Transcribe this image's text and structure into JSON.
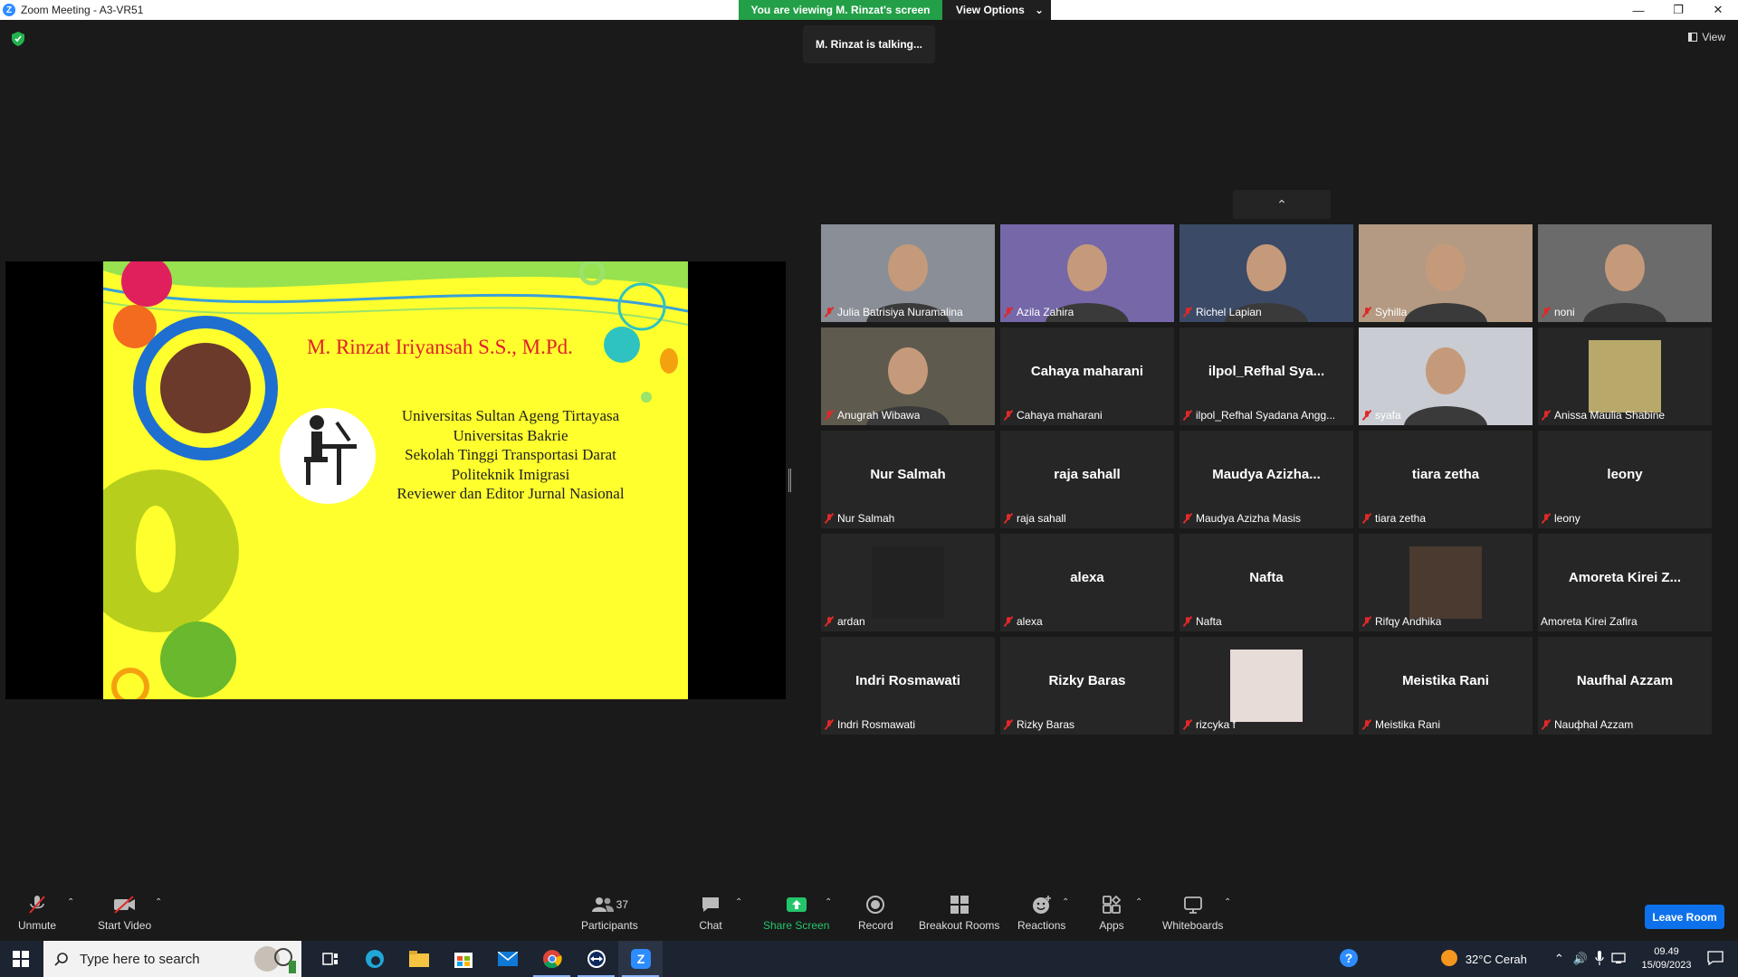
{
  "window": {
    "title": "Zoom Meeting - A3-VR51"
  },
  "banner": {
    "viewing_text": "You are viewing M. Rinzat's screen",
    "options_label": "View Options"
  },
  "talking": "M. Rinzat is talking...",
  "view_label": "View",
  "slide": {
    "name": "M. Rinzat Iriyansah S.S., M.Pd.",
    "lines": [
      "Universitas Sultan Ageng Tirtayasa",
      "Universitas Bakrie",
      "Sekolah Tinggi Transportasi Darat",
      "Politeknik Imigrasi",
      "Reviewer dan Editor Jurnal Nasional"
    ]
  },
  "participants": [
    {
      "label": "Julia Batrisiya Nuramalina",
      "big": "",
      "video": true,
      "bg": "#8a8f97"
    },
    {
      "label": "Azila Zahira",
      "big": "",
      "video": true,
      "bg": "#7567a8"
    },
    {
      "label": "Richel Lapian",
      "big": "",
      "video": true,
      "bg": "#3b4a66"
    },
    {
      "label": "Syhilla",
      "big": "",
      "video": true,
      "bg": "#b49a82"
    },
    {
      "label": "noni",
      "big": "",
      "video": true,
      "bg": "#6b6b6b"
    },
    {
      "label": "Anugrah Wibawa",
      "big": "",
      "video": true,
      "bg": "#5f5a4e"
    },
    {
      "label": "Cahaya maharani",
      "big": "Cahaya maharani",
      "video": false
    },
    {
      "label": "ilpol_Refhal Syadana Angg...",
      "big": "ilpol_Refhal  Sya...",
      "video": false
    },
    {
      "label": "syafa",
      "big": "",
      "video": true,
      "bg": "#c9ccd3"
    },
    {
      "label": "Anissa Maulia Shabine",
      "big": "",
      "video": false,
      "avatar": "#b8a86a"
    },
    {
      "label": "Nur Salmah",
      "big": "Nur Salmah",
      "video": false
    },
    {
      "label": "raja sahall",
      "big": "raja sahall",
      "video": false
    },
    {
      "label": "Maudya Azizha Masis",
      "big": "Maudya  Azizha...",
      "video": false
    },
    {
      "label": "tiara zetha",
      "big": "tiara zetha",
      "video": false
    },
    {
      "label": "leony",
      "big": "leony",
      "video": false
    },
    {
      "label": "ardan",
      "big": "",
      "video": false,
      "avatar": "#222222"
    },
    {
      "label": "alexa",
      "big": "alexa",
      "video": false
    },
    {
      "label": "Nafta",
      "big": "Nafta",
      "video": false
    },
    {
      "label": "Rifqy Andhika",
      "big": "",
      "video": false,
      "avatar": "#4a3a30"
    },
    {
      "label": "Amoreta Kirei Zafira",
      "big": "Amoreta  Kirei  Z...",
      "video": false,
      "nomic": true
    },
    {
      "label": "Indri Rosmawati",
      "big": "Indri Rosmawati",
      "video": false
    },
    {
      "label": "Rizky Baras",
      "big": "Rizky Baras",
      "video": false
    },
    {
      "label": "rizcyka f",
      "big": "",
      "video": false,
      "avatar": "#e8dcd8"
    },
    {
      "label": "Meistika Rani",
      "big": "Meistika Rani",
      "video": false
    },
    {
      "label": "Nauфhal Azzam",
      "big": "Naufhal Azzam",
      "video": false
    }
  ],
  "toolbar": {
    "unmute": "Unmute",
    "start_video": "Start Video",
    "participants": "Participants",
    "participants_count": "37",
    "chat": "Chat",
    "share_screen": "Share Screen",
    "record": "Record",
    "breakout": "Breakout Rooms",
    "reactions": "Reactions",
    "apps": "Apps",
    "whiteboards": "Whiteboards",
    "leave": "Leave Room"
  },
  "taskbar": {
    "search_placeholder": "Type here to search",
    "weather": "32°C  Cerah",
    "time": "09.49",
    "date": "15/09/2023"
  },
  "colors": {
    "accent": "#0e71eb",
    "banner_green": "#23a047",
    "slide_bg": "#ffff2e",
    "name_red": "#e0202a"
  }
}
